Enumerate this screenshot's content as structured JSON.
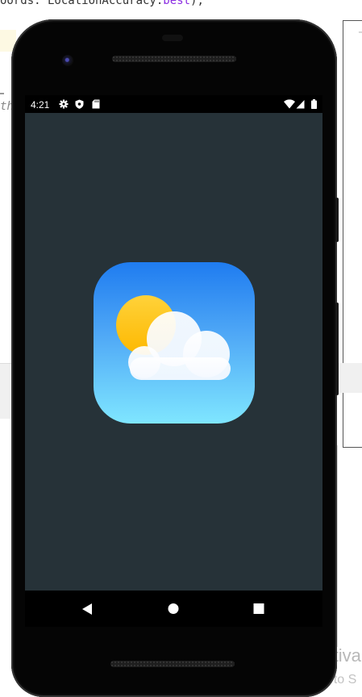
{
  "background": {
    "code_line_top": "oords: LocationAccuracy.best);",
    "code_keyword": "best",
    "italic_fragment": "th",
    "activate_title": "Activa",
    "activate_subtitle": "Go to S"
  },
  "status_bar": {
    "time": "4:21",
    "left_icons": [
      "settings-icon",
      "shield-icon",
      "sd-card-icon"
    ],
    "right_icons": [
      "wifi-icon",
      "signal-icon",
      "battery-icon"
    ]
  },
  "screen": {
    "background_color": "#263238",
    "splash_icon": "weather-app-icon"
  },
  "navigation": {
    "buttons": [
      "back-icon",
      "home-icon",
      "recents-icon"
    ]
  }
}
